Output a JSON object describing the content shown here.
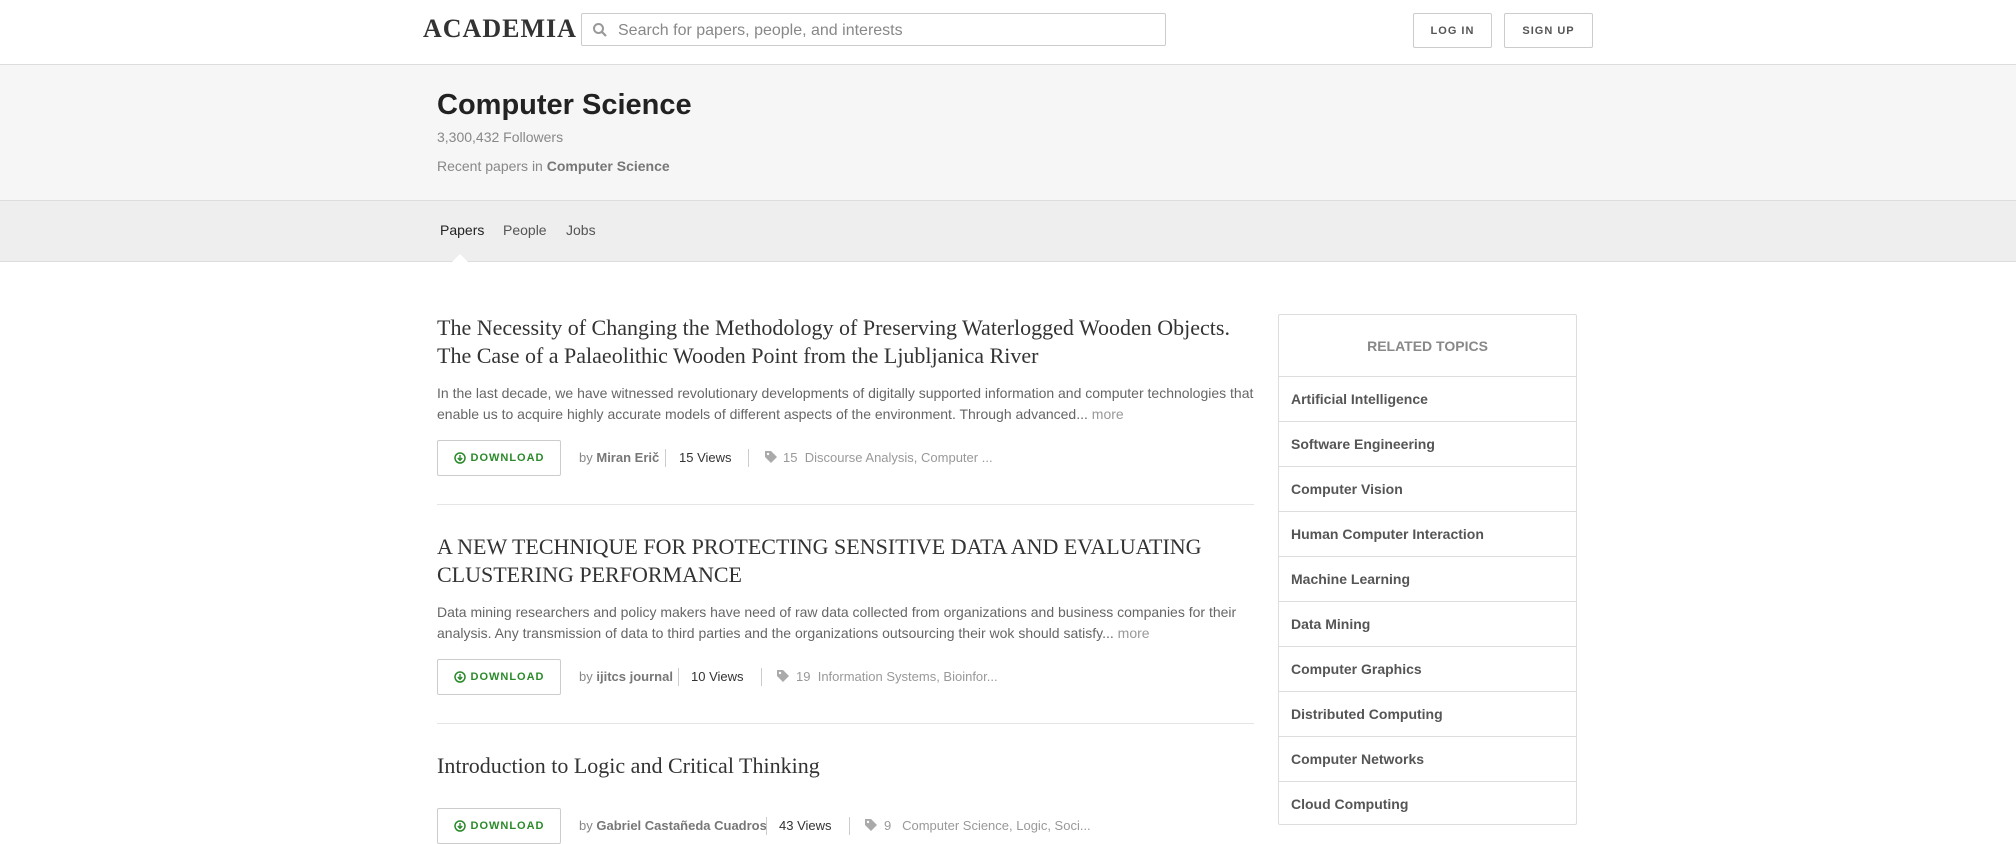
{
  "header": {
    "logo": "ACADEMIA",
    "search_placeholder": "Search for papers, people, and interests",
    "login": "LOG IN",
    "signup": "SIGN UP"
  },
  "hero": {
    "title": "Computer Science",
    "followers": "3,300,432 Followers",
    "recent_prefix": "Recent papers in",
    "recent_topic": "Computer Science"
  },
  "tabs": [
    "Papers",
    "People",
    "Jobs"
  ],
  "papers": [
    {
      "title": "The Necessity of Changing the Methodology of Preserving Waterlogged Wooden Objects. The Case of a Palaeolithic Wooden Point from the Ljubljanica River",
      "abstract": "In the last decade, we have witnessed revolutionary developments of digitally supported information and computer technologies that enable us to acquire highly accurate models of different aspects of the environment. Through advanced...",
      "more": "more",
      "download": "DOWNLOAD",
      "by": "by",
      "author": "Miran Erič",
      "views": "15 Views",
      "tag_count": "15",
      "tags": "Discourse Analysis, Computer ..."
    },
    {
      "title": "A NEW TECHNIQUE FOR PROTECTING SENSITIVE DATA AND EVALUATING CLUSTERING PERFORMANCE",
      "abstract": "Data mining researchers and policy makers have need of raw data collected from organizations and business companies for their analysis. Any transmission of data to third parties and the organizations outsourcing their wok should satisfy...",
      "more": "more",
      "download": "DOWNLOAD",
      "by": "by",
      "author": "ijitcs journal",
      "views": "10 Views",
      "tag_count": "19",
      "tags": "Information Systems, Bioinfor..."
    },
    {
      "title": "Introduction to Logic and Critical Thinking",
      "download": "DOWNLOAD",
      "by": "by",
      "author": "Gabriel Castañeda Cuadros",
      "views": "43 Views",
      "tag_count": "9",
      "tags": "Computer Science, Logic, Soci..."
    }
  ],
  "related": {
    "heading": "RELATED TOPICS",
    "items": [
      "Artificial Intelligence",
      "Software Engineering",
      "Computer Vision",
      "Human Computer Interaction",
      "Machine Learning",
      "Data Mining",
      "Computer Graphics",
      "Distributed Computing",
      "Computer Networks",
      "Cloud Computing"
    ]
  },
  "colors": {
    "download_green": "#2a8a2a",
    "hero_bg": "#f6f6f6",
    "tabs_bg": "#eeeeee"
  }
}
